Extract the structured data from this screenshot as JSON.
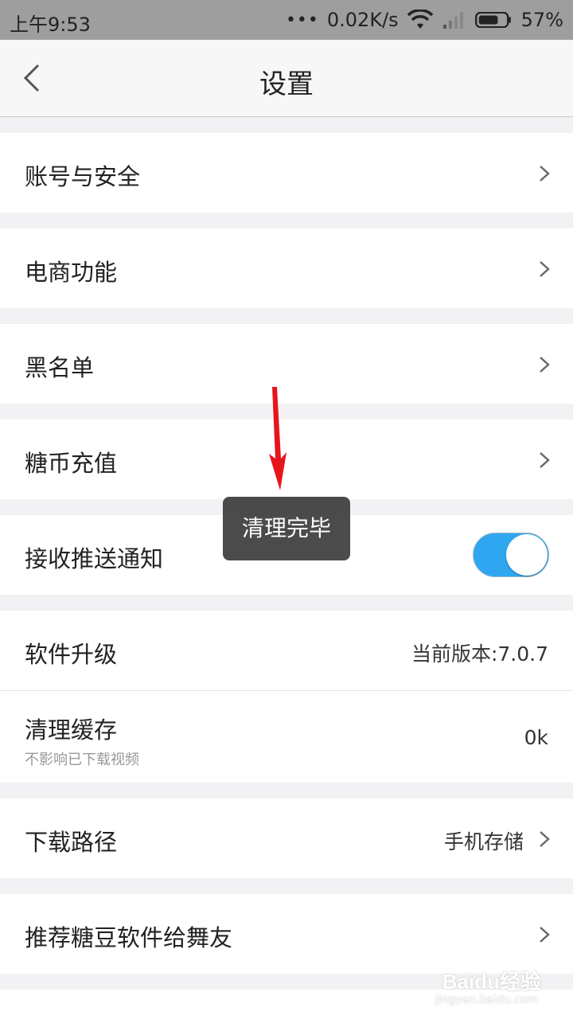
{
  "status_bar": {
    "time": "上午9:53",
    "dots": "•••",
    "speed": "0.02K/s",
    "battery": "57%"
  },
  "navbar": {
    "title": "设置",
    "back_icon": "chevron-left-icon"
  },
  "settings": {
    "account_security": "账号与安全",
    "ecommerce": "电商功能",
    "blacklist": "黑名单",
    "recharge": "糖币充值",
    "push_notifications": "接收推送通知",
    "push_enabled": true,
    "software_update": "软件升级",
    "current_version": "当前版本:7.0.7",
    "clear_cache": "清理缓存",
    "clear_cache_note": "不影响已下载视频",
    "cache_size": "0k",
    "download_path": "下载路径",
    "download_path_value": "手机存储",
    "recommend": "推荐糖豆软件给舞友"
  },
  "toast": {
    "text": "清理完毕"
  },
  "colors": {
    "toggle_on": "#2ea7f0",
    "arrow": "#e8141b"
  },
  "watermark": {
    "text": "Baidu经验",
    "sub": "jingyan.baidu.com"
  }
}
